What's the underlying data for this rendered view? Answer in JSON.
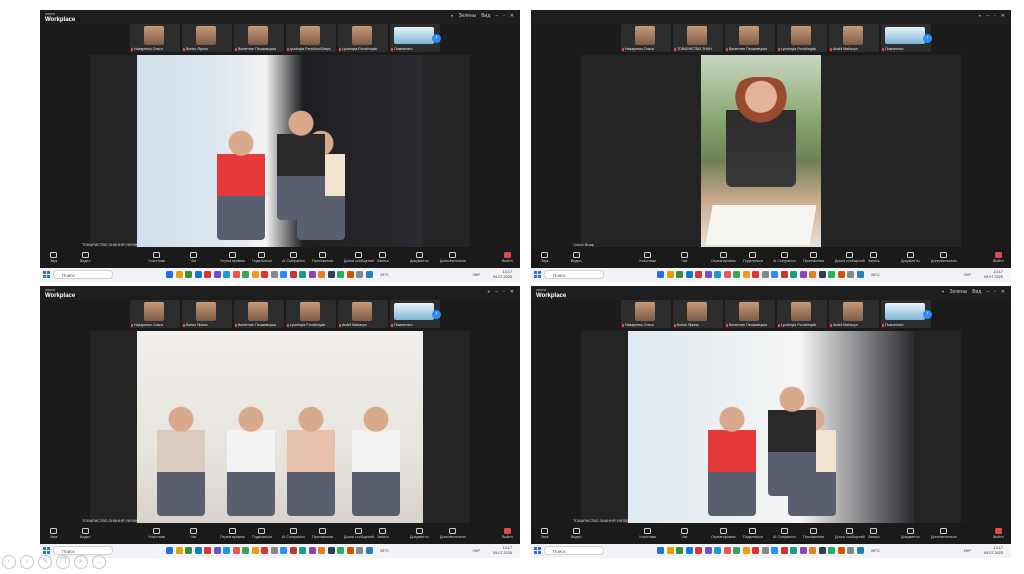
{
  "screens": [
    {
      "app_label_small": "zoom",
      "app_label": "Workplace",
      "top_status": [
        "Зелены",
        "Вид"
      ],
      "thumbnails": [
        {
          "kind": "face",
          "label": "Назаренко Ольга"
        },
        {
          "kind": "face",
          "label": "Bonko Ярина"
        },
        {
          "kind": "face",
          "label": "Валентин Пешанецька"
        },
        {
          "kind": "face",
          "label": "lyudmyla Perokhod Бюро"
        },
        {
          "kind": "face",
          "label": "Lyudmyla Porokhnyak"
        },
        {
          "kind": "logo",
          "label": "Помчетино"
        }
      ],
      "participant_title": "lyudmyla Porok…",
      "video_label": "ТОВАРИСТВО ЗНАННЯ УКРАЇНИ",
      "scene": "panel"
    },
    {
      "app_label_small": "",
      "app_label": "",
      "top_status": [],
      "thumbnails": [
        {
          "kind": "face",
          "label": "Назаренко Ольга"
        },
        {
          "kind": "face",
          "label": "ТОВАРИСТВО ЗНАН"
        },
        {
          "kind": "face",
          "label": "Валентин Пешанецька"
        },
        {
          "kind": "face",
          "label": "Lyudmyla Porokhnyak"
        },
        {
          "kind": "face",
          "label": "Andrii Mahazyn"
        },
        {
          "kind": "logo",
          "label": "Помчетино"
        }
      ],
      "participant_titles": [
        "lyudmyla Porok…",
        "Andrii Mahazyn…"
      ],
      "video_label": "Ольга Візир",
      "scene": "speaker"
    },
    {
      "app_label_small": "zoom",
      "app_label": "Workplace",
      "top_status": [],
      "thumbnails": [
        {
          "kind": "face",
          "label": "Назаренко Ольга"
        },
        {
          "kind": "face",
          "label": "Бонко Ярина"
        },
        {
          "kind": "face",
          "label": "Валентин Пешанецька"
        },
        {
          "kind": "face",
          "label": "Lyudmyla Porokhnyak"
        },
        {
          "kind": "face",
          "label": "Andrii Mahazyn"
        },
        {
          "kind": "logo",
          "label": "Помчетино"
        }
      ],
      "participant_titles": [
        "lyudmyla Porok…",
        "Andrii Mahazyn…"
      ],
      "video_label": "ТОВАРИСТВО ЗНАННЯ УКРАЇНИ",
      "scene": "panel2"
    },
    {
      "app_label_small": "zoom",
      "app_label": "Workplace",
      "top_status": [
        "Зелены",
        "Вид"
      ],
      "thumbnails": [
        {
          "kind": "face",
          "label": "Назаренко Ольга"
        },
        {
          "kind": "face",
          "label": "Бонко Ярина"
        },
        {
          "kind": "face",
          "label": "Валентин Пешанецька"
        },
        {
          "kind": "face",
          "label": "Lyudmyla Porokhnyak"
        },
        {
          "kind": "face",
          "label": "Andrii Mahazyn"
        },
        {
          "kind": "logo",
          "label": "Помчетино"
        }
      ],
      "participant_titles": [
        "lyudmyla Porok…",
        "Andrii Mahazyn…"
      ],
      "video_label": "ТОВАРИСТВО ЗНАННЯ УКРАЇНИ",
      "scene": "panel3"
    }
  ],
  "toolbar": [
    {
      "label": "Звук",
      "icon": "mic-icon"
    },
    {
      "label": "Видео",
      "icon": "camera-icon"
    },
    {
      "label": "Участники",
      "icon": "people-icon"
    },
    {
      "label": "Чат",
      "icon": "chat-icon"
    },
    {
      "label": "Отреагировать",
      "icon": "heart-icon"
    },
    {
      "label": "Поделиться",
      "icon": "share-icon"
    },
    {
      "label": "AI Companion",
      "icon": "sparkle-icon"
    },
    {
      "label": "Приложения",
      "icon": "apps-icon"
    },
    {
      "label": "Доска сообщений",
      "icon": "whiteboard-icon"
    },
    {
      "label": "Запись",
      "icon": "record-icon"
    },
    {
      "label": "Документы",
      "icon": "docs-icon"
    },
    {
      "label": "Дополнительно",
      "icon": "more-icon"
    },
    {
      "label": "Выйти",
      "icon": "leave-icon"
    }
  ],
  "taskbar": {
    "search_placeholder": "Поиск",
    "weather": "28°C",
    "lang": "УКР",
    "time": "13:17",
    "date": "09.07.2025"
  },
  "colors": {
    "zoom_blue": "#2d8cff",
    "leave_red": "#e04a4a",
    "taskbar_bg": "#f1f3f6"
  }
}
